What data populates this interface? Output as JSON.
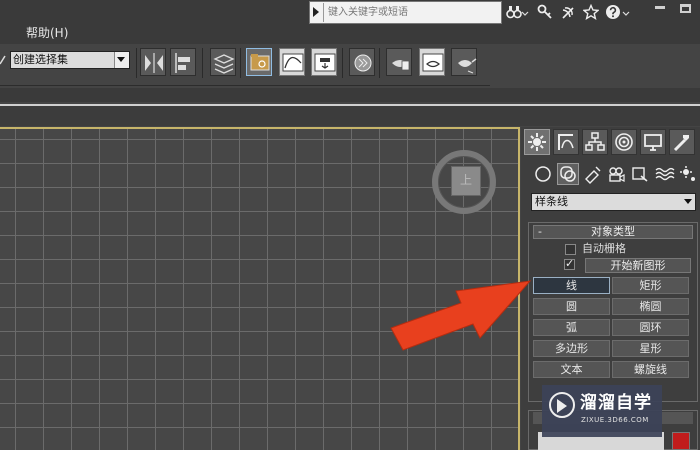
{
  "menu": {
    "help": "帮助(H)"
  },
  "search": {
    "placeholder": "键入关键字或短语"
  },
  "title_icons": [
    "binoculars-icon",
    "key-icon",
    "signal-icon",
    "star-icon",
    "help-icon",
    "chevron-down-icon"
  ],
  "toolbar": {
    "selection_set": "创建选择集",
    "icons": [
      "mirror-icon",
      "align-icon",
      "layer-manager-icon",
      "scene-explorer-icon",
      "curve-editor-icon",
      "schematic-view-icon",
      "material-editor-icon",
      "render-setup-icon",
      "rendered-frame-icon",
      "render-teapot-icon"
    ]
  },
  "viewport": {
    "viewcube_label": "上"
  },
  "command_panel": {
    "tabs": [
      "create-tab",
      "modify-tab",
      "hierarchy-tab",
      "motion-tab",
      "display-tab",
      "utilities-tab"
    ],
    "sub_icons": [
      "geometry-icon",
      "shapes-icon",
      "lights-icon",
      "cameras-icon",
      "helpers-icon",
      "spacewarps-icon",
      "systems-icon"
    ],
    "category": "样条线",
    "object_type": {
      "collapse": "-",
      "title": "对象类型",
      "autogrid": "自动栅格",
      "check": "✓",
      "start_new_shape": "开始新图形",
      "buttons": [
        [
          "线",
          "矩形"
        ],
        [
          "圆",
          "椭圆"
        ],
        [
          "弧",
          "圆环"
        ],
        [
          "多边形",
          "星形"
        ],
        [
          "文本",
          "螺旋线"
        ]
      ],
      "selected": "线"
    },
    "color_swatch": "#c11c1c"
  },
  "watermark": {
    "text": "溜溜自学",
    "url": "ZIXUE.3D66.COM"
  },
  "colors": {
    "viewport_border": "#c7b56a",
    "arrow": "#e8401e",
    "selected_button": "#2d3640"
  }
}
